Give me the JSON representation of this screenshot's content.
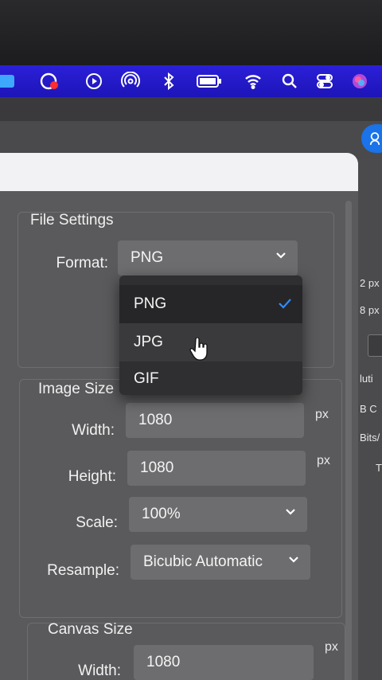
{
  "menubar": {
    "icons": [
      "finder-icon",
      "creative-cloud-icon",
      "play-icon",
      "airdrop-icon",
      "bluetooth-icon",
      "battery-icon",
      "wifi-icon",
      "search-icon",
      "control-center-icon",
      "siri-icon"
    ],
    "color": "#2418d0"
  },
  "file_settings": {
    "title": "File Settings",
    "format_label": "Format:",
    "format_value": "PNG",
    "format_options": [
      {
        "label": "PNG",
        "selected": true
      },
      {
        "label": "JPG",
        "selected": false
      },
      {
        "label": "GIF",
        "selected": false
      }
    ]
  },
  "image_size": {
    "title": "Image Size",
    "width_label": "Width:",
    "width_value": "1080",
    "height_label": "Height:",
    "height_value": "1080",
    "unit": "px",
    "scale_label": "Scale:",
    "scale_value": "100%",
    "resample_label": "Resample:",
    "resample_value": "Bicubic Automatic"
  },
  "canvas_size": {
    "title": "Canvas Size",
    "width_label": "Width:",
    "width_value": "1080",
    "unit": "px"
  },
  "right_panel": {
    "labels": [
      "2 px",
      "8 px",
      "luti",
      "B C",
      "Bits/",
      "T"
    ]
  }
}
